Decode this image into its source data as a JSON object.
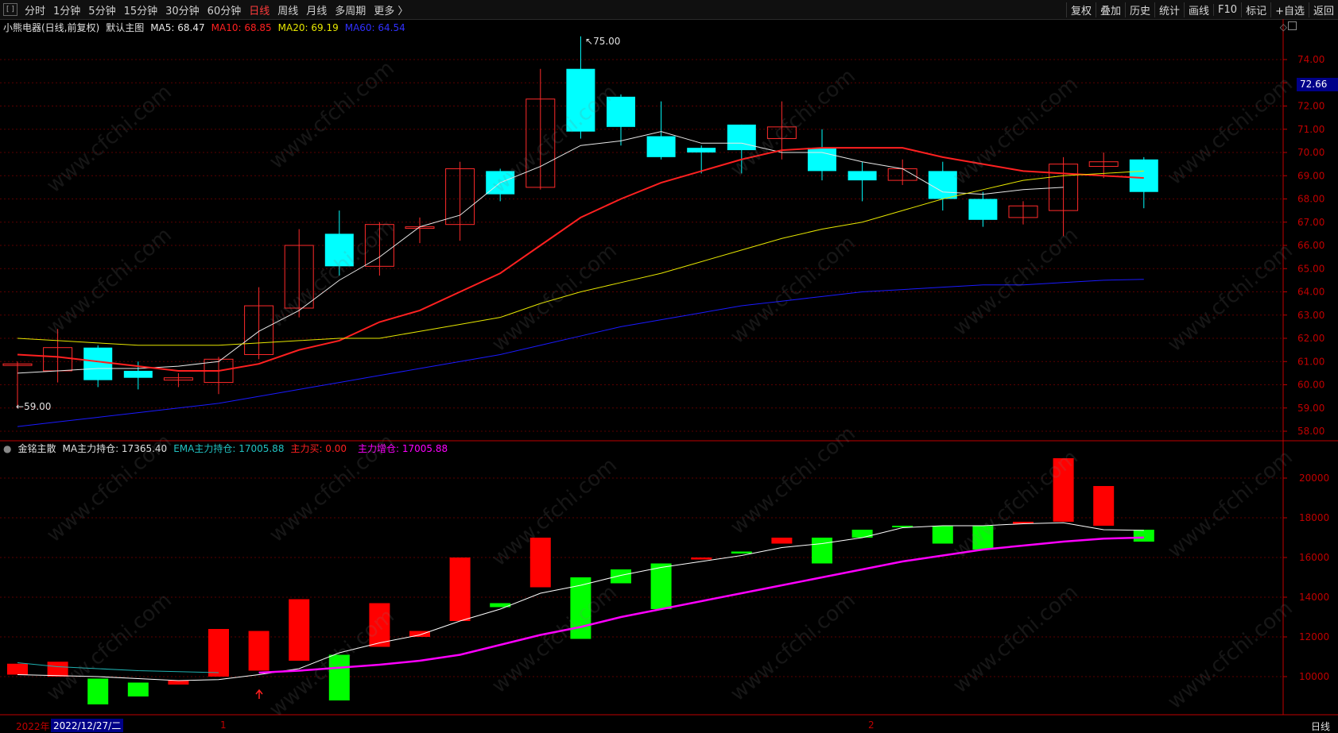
{
  "toolbar": {
    "periods": [
      "分时",
      "1分钟",
      "5分钟",
      "15分钟",
      "30分钟",
      "60分钟",
      "日线",
      "周线",
      "月线",
      "多周期",
      "更多 〉"
    ],
    "active_period": "日线",
    "right_buttons": [
      "复权",
      "叠加",
      "历史",
      "统计",
      "画线",
      "F10",
      "标记",
      "+自选",
      "返回"
    ]
  },
  "main_header": {
    "stock": "小熊电器(日线,前复权)",
    "template": "默认主图",
    "ma5": "MA5: 68.47",
    "ma10": "MA10: 68.85",
    "ma20": "MA20: 69.19",
    "ma60": "MA60: 64.54"
  },
  "sub_header": {
    "name": "金铭主散",
    "ma_hold": "MA主力持仓: 17365.40",
    "ema_hold": "EMA主力持仓: 17005.88",
    "buy": "主力买: 0.00",
    "add": "主力增仓: 17005.88"
  },
  "annotations": {
    "high": "75.00",
    "low": "59.00",
    "last_price": "72.66"
  },
  "x_axis": {
    "year": "2022年",
    "date": "2022/12/27/二",
    "month1": "1",
    "month2": "2",
    "period": "日线"
  },
  "watermark": "www.cfchi.com",
  "colors": {
    "up": "#ff2a2a",
    "down": "#00ffff",
    "ma5": "#e8e8e8",
    "ma10": "#ff2020",
    "ma20": "#e6e600",
    "ma60": "#1a1aff",
    "sub_up": "#ff0000",
    "sub_down": "#00ff00",
    "ema": "#ff00ff",
    "ma_line": "#ffffff"
  },
  "chart_data": [
    {
      "type": "candlestick",
      "title": "小熊电器(日线,前复权)",
      "ylim": [
        57.6,
        75.6
      ],
      "yticks": [
        58,
        59,
        60,
        61,
        62,
        63,
        64,
        65,
        66,
        67,
        68,
        69,
        70,
        71,
        72,
        73,
        74
      ],
      "candles": [
        {
          "o": 60.9,
          "c": 60.9,
          "h": 61.0,
          "l": 59.0
        },
        {
          "o": 60.6,
          "c": 61.6,
          "h": 62.4,
          "l": 60.1
        },
        {
          "o": 61.6,
          "c": 60.2,
          "h": 61.7,
          "l": 59.9
        },
        {
          "o": 60.6,
          "c": 60.3,
          "h": 61.0,
          "l": 59.8
        },
        {
          "o": 60.2,
          "c": 60.3,
          "h": 60.5,
          "l": 59.9
        },
        {
          "o": 60.1,
          "c": 61.1,
          "h": 61.2,
          "l": 59.6
        },
        {
          "o": 61.3,
          "c": 63.4,
          "h": 64.2,
          "l": 61.1
        },
        {
          "o": 63.3,
          "c": 66.0,
          "h": 66.7,
          "l": 62.9
        },
        {
          "o": 66.5,
          "c": 65.1,
          "h": 67.5,
          "l": 64.7
        },
        {
          "o": 65.1,
          "c": 66.9,
          "h": 67.0,
          "l": 64.7
        },
        {
          "o": 66.8,
          "c": 66.8,
          "h": 67.2,
          "l": 66.1
        },
        {
          "o": 66.9,
          "c": 69.3,
          "h": 69.6,
          "l": 66.2
        },
        {
          "o": 69.2,
          "c": 68.2,
          "h": 69.3,
          "l": 67.9
        },
        {
          "o": 68.5,
          "c": 72.3,
          "h": 73.6,
          "l": 68.4
        },
        {
          "o": 73.6,
          "c": 70.9,
          "h": 75.0,
          "l": 70.6
        },
        {
          "o": 72.4,
          "c": 71.1,
          "h": 72.5,
          "l": 70.3
        },
        {
          "o": 70.7,
          "c": 69.8,
          "h": 72.2,
          "l": 69.7
        },
        {
          "o": 70.2,
          "c": 70.0,
          "h": 70.3,
          "l": 69.1
        },
        {
          "o": 71.2,
          "c": 70.1,
          "h": 71.2,
          "l": 69.1
        },
        {
          "o": 70.6,
          "c": 71.1,
          "h": 72.2,
          "l": 69.7
        },
        {
          "o": 70.2,
          "c": 69.2,
          "h": 71.0,
          "l": 68.8
        },
        {
          "o": 69.2,
          "c": 68.8,
          "h": 69.6,
          "l": 67.9
        },
        {
          "o": 68.8,
          "c": 69.3,
          "h": 69.7,
          "l": 68.6
        },
        {
          "o": 69.2,
          "c": 68.0,
          "h": 69.6,
          "l": 67.5
        },
        {
          "o": 68.0,
          "c": 67.1,
          "h": 68.3,
          "l": 66.8
        },
        {
          "o": 67.2,
          "c": 67.7,
          "h": 67.9,
          "l": 66.9
        },
        {
          "o": 67.5,
          "c": 69.5,
          "h": 69.8,
          "l": 66.4
        },
        {
          "o": 69.4,
          "c": 69.6,
          "h": 70.0,
          "l": 68.9
        },
        {
          "o": 69.7,
          "c": 68.3,
          "h": 69.8,
          "l": 67.6
        }
      ],
      "series": [
        {
          "name": "MA5",
          "values": [
            60.5,
            60.6,
            60.7,
            60.7,
            60.8,
            61.0,
            62.3,
            63.2,
            64.5,
            65.5,
            66.8,
            67.3,
            68.7,
            69.4,
            70.3,
            70.5,
            70.9,
            70.4,
            70.4,
            70.0,
            70.0,
            69.6,
            69.3,
            68.3,
            68.2,
            68.4,
            68.5,
            null,
            null
          ]
        },
        {
          "name": "MA10",
          "values": [
            61.3,
            61.2,
            61.0,
            60.8,
            60.6,
            60.6,
            60.9,
            61.5,
            61.9,
            62.7,
            63.2,
            64.0,
            64.8,
            66.0,
            67.2,
            68.0,
            68.7,
            69.2,
            69.7,
            70.1,
            70.2,
            70.2,
            70.2,
            69.8,
            69.5,
            69.2,
            69.1,
            69.0,
            68.9
          ]
        },
        {
          "name": "MA20",
          "values": [
            62.0,
            61.9,
            61.8,
            61.7,
            61.7,
            61.7,
            61.8,
            61.9,
            62.0,
            62.0,
            62.3,
            62.6,
            62.9,
            63.5,
            64.0,
            64.4,
            64.8,
            65.3,
            65.8,
            66.3,
            66.7,
            67.0,
            67.5,
            68.0,
            68.4,
            68.8,
            69.0,
            69.1,
            69.2
          ]
        },
        {
          "name": "MA60",
          "values": [
            58.2,
            58.4,
            58.6,
            58.8,
            59.0,
            59.2,
            59.5,
            59.8,
            60.1,
            60.4,
            60.7,
            61.0,
            61.3,
            61.7,
            62.1,
            62.5,
            62.8,
            63.1,
            63.4,
            63.6,
            63.8,
            64.0,
            64.1,
            64.2,
            64.3,
            64.3,
            64.4,
            64.5,
            64.54
          ]
        }
      ]
    },
    {
      "type": "bar",
      "title": "金铭主散",
      "ylim": [
        8500,
        21800
      ],
      "yticks": [
        10000,
        12000,
        14000,
        16000,
        18000,
        20000
      ],
      "bars": [
        {
          "a": 10650,
          "b": 10100
        },
        {
          "a": 10750,
          "b": 10000
        },
        {
          "a": 9900,
          "b": 8600
        },
        {
          "a": 9700,
          "b": 9000
        },
        {
          "a": 9800,
          "b": 9600
        },
        {
          "a": 12400,
          "b": 10000
        },
        {
          "a": 12300,
          "b": 10300
        },
        {
          "a": 13900,
          "b": 10800
        },
        {
          "a": 11100,
          "b": 8800
        },
        {
          "a": 13700,
          "b": 11500
        },
        {
          "a": 12300,
          "b": 12000
        },
        {
          "a": 16000,
          "b": 12800
        },
        {
          "a": 13700,
          "b": 13500
        },
        {
          "a": 17000,
          "b": 14500
        },
        {
          "a": 15000,
          "b": 11900
        },
        {
          "a": 15400,
          "b": 14700
        },
        {
          "a": 15700,
          "b": 13400
        },
        {
          "a": 16000,
          "b": 15900
        },
        {
          "a": 16300,
          "b": 16200
        },
        {
          "a": 17000,
          "b": 16700
        },
        {
          "a": 17000,
          "b": 15700
        },
        {
          "a": 17400,
          "b": 17000
        },
        {
          "a": 17600,
          "b": 17550
        },
        {
          "a": 17600,
          "b": 16700
        },
        {
          "a": 17600,
          "b": 16400
        },
        {
          "a": 17800,
          "b": 17700
        },
        {
          "a": 21000,
          "b": 17800
        },
        {
          "a": 19600,
          "b": 17600
        },
        {
          "a": 17400,
          "b": 16800
        }
      ],
      "up_flags": [
        1,
        1,
        0,
        0,
        1,
        1,
        1,
        1,
        0,
        1,
        1,
        1,
        0,
        1,
        0,
        0,
        0,
        1,
        0,
        1,
        0,
        0,
        0,
        0,
        0,
        1,
        1,
        1,
        0
      ],
      "series": [
        {
          "name": "MA主力持仓",
          "values": [
            10100,
            10050,
            10000,
            9900,
            9800,
            9850,
            10100,
            10400,
            11200,
            11700,
            12100,
            12800,
            13400,
            14200,
            14600,
            15100,
            15500,
            15800,
            16100,
            16500,
            16700,
            17000,
            17500,
            17600,
            17600,
            17700,
            17750,
            17400,
            17365
          ]
        },
        {
          "name": "EMA主力持仓",
          "values": [
            null,
            null,
            null,
            null,
            null,
            null,
            10200,
            10300,
            10450,
            10600,
            10800,
            11100,
            11600,
            12100,
            12500,
            13000,
            13400,
            13800,
            14200,
            14600,
            15000,
            15400,
            15800,
            16100,
            16400,
            16600,
            16800,
            16950,
            17005
          ]
        },
        {
          "name": "EMA_cyan",
          "values": [
            10700,
            10500,
            10400,
            10300,
            10250,
            10200,
            null,
            null,
            null,
            null,
            null,
            null,
            null,
            null,
            null,
            null,
            null,
            null,
            null,
            null,
            null,
            null,
            null,
            null,
            null,
            null,
            null,
            null,
            null
          ]
        }
      ]
    }
  ]
}
